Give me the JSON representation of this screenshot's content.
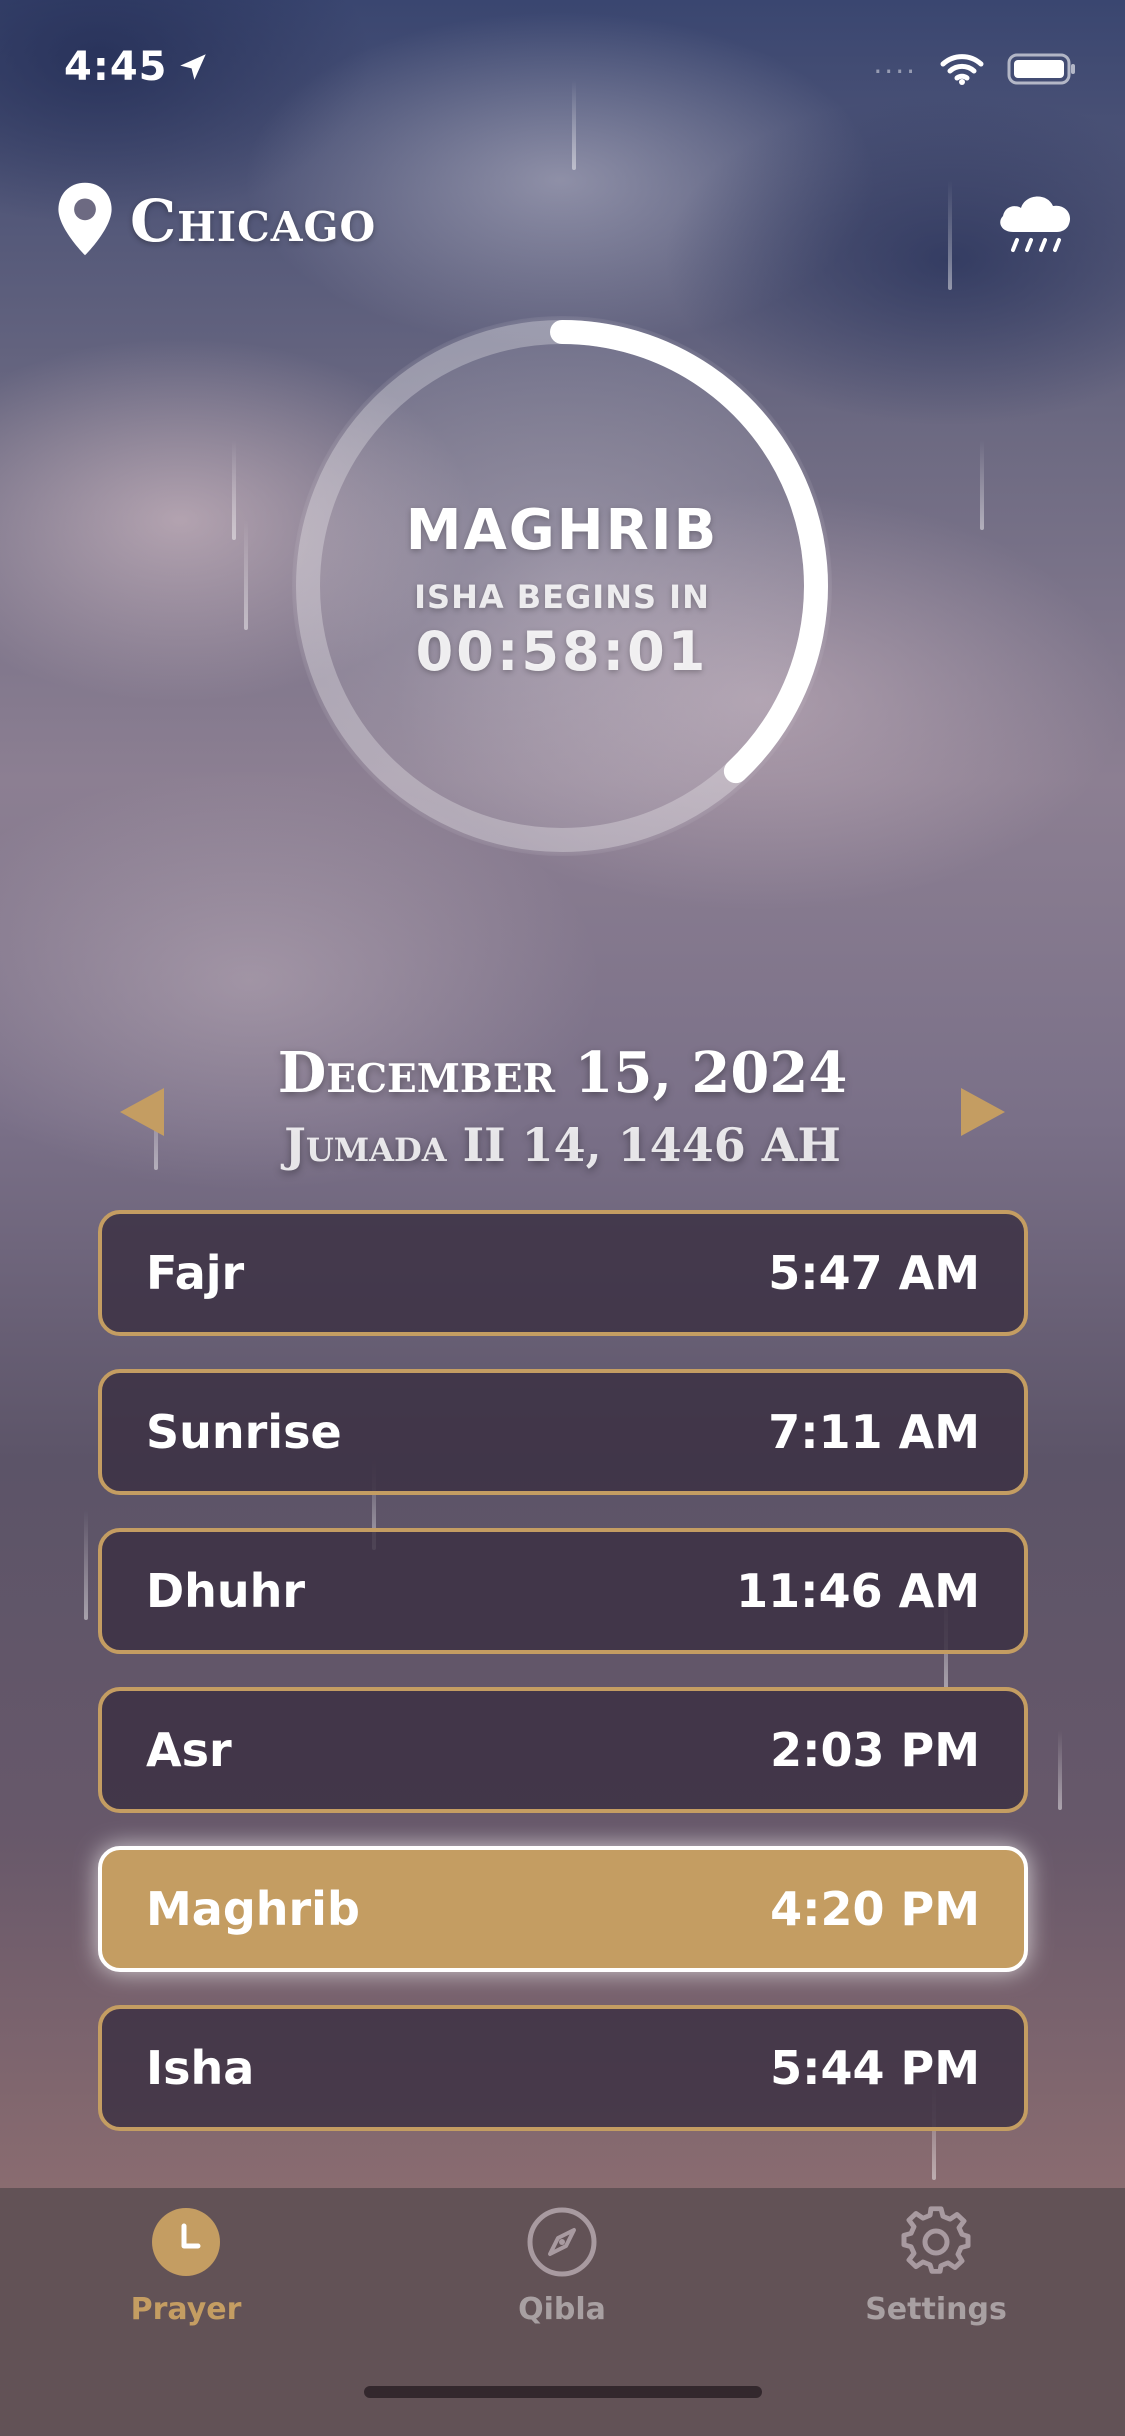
{
  "status_bar": {
    "time": "4:45"
  },
  "header": {
    "city": "Chicago"
  },
  "countdown": {
    "current_prayer": "MAGHRIB",
    "next_label": "ISHA BEGINS IN",
    "remaining": "00:58:01",
    "progress": 0.38
  },
  "date": {
    "gregorian": "December 15, 2024",
    "hijri": "Jumada II 14, 1446 AH"
  },
  "prayers": [
    {
      "name": "Fajr",
      "time": "5:47 AM"
    },
    {
      "name": "Sunrise",
      "time": "7:11 AM"
    },
    {
      "name": "Dhuhr",
      "time": "11:46 AM"
    },
    {
      "name": "Asr",
      "time": "2:03 PM"
    },
    {
      "name": "Maghrib",
      "time": "4:20 PM"
    },
    {
      "name": "Isha",
      "time": "5:44 PM"
    }
  ],
  "active_prayer": "Maghrib",
  "tabs": [
    {
      "label": "Prayer",
      "icon": "clock-icon",
      "selected": true
    },
    {
      "label": "Qibla",
      "icon": "compass-icon",
      "selected": false
    },
    {
      "label": "Settings",
      "icon": "gear-icon",
      "selected": false
    }
  ],
  "colors": {
    "accent": "#c49d62",
    "row_bg": "#3a3042",
    "tab_inactive": "#a89aa0"
  }
}
